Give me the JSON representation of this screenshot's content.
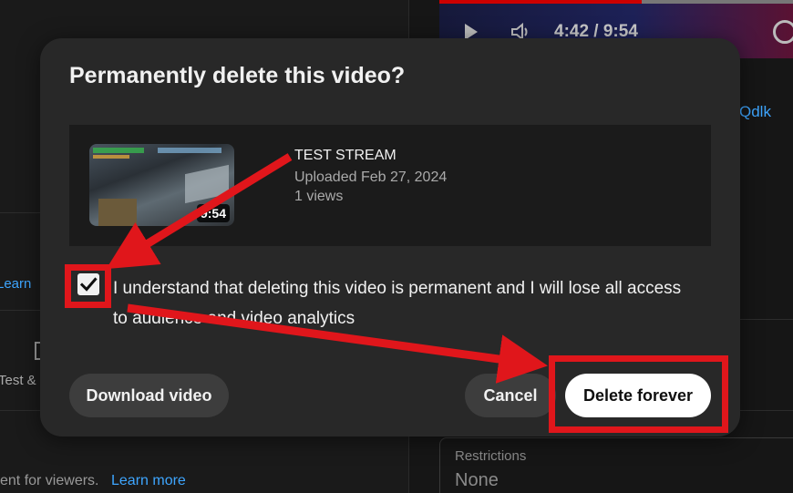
{
  "background": {
    "player_time": "4:42 / 9:54",
    "link_fragment": "Qdlk",
    "learn_fragment": "Learn",
    "test_fragment": "Test &",
    "footer_text": "ent for viewers.",
    "footer_link": "Learn more",
    "restrictions_label": "Restrictions",
    "restrictions_value": "None"
  },
  "dialog": {
    "title": "Permanently delete this video?",
    "video": {
      "title": "TEST STREAM",
      "uploaded": "Uploaded Feb 27, 2024",
      "views": "1 views",
      "duration": "9:54"
    },
    "confirm": {
      "checked": true,
      "text": "I understand that deleting this video is permanent and I will lose all access to audience and video analytics"
    },
    "buttons": {
      "download": "Download video",
      "cancel": "Cancel",
      "delete": "Delete forever"
    }
  },
  "colors": {
    "dialog_bg": "#282828",
    "card_bg": "#1b1b1b",
    "annotation_red": "#e0161b",
    "link_blue": "#3ea6ff",
    "progress_red": "#cc0000"
  },
  "icons": {
    "checkbox": "check-icon",
    "play": "play-icon",
    "volume": "volume-icon",
    "settings": "gear-icon"
  }
}
